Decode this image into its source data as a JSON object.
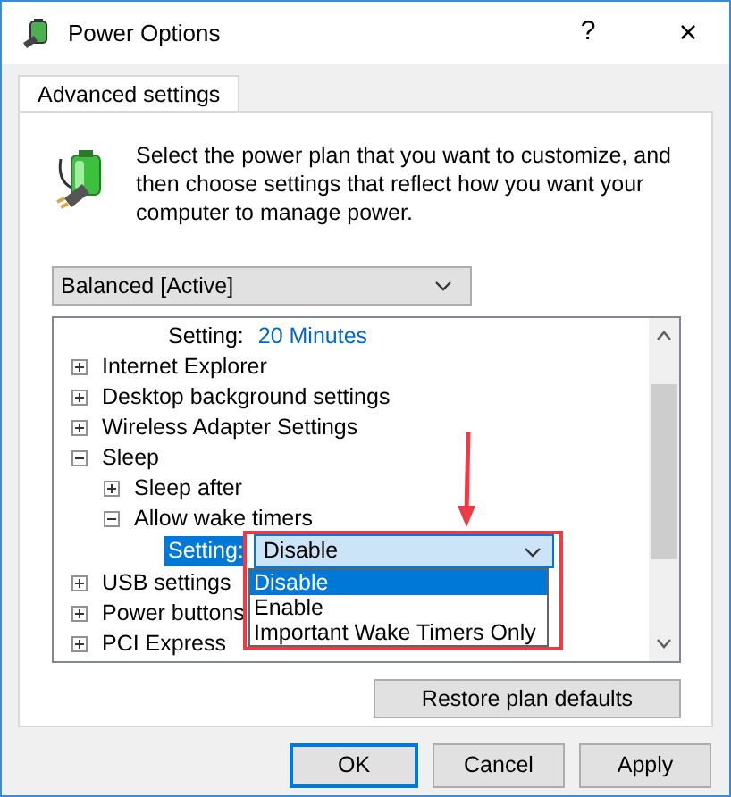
{
  "window": {
    "title": "Power Options",
    "help_button": "?",
    "close_button": "×"
  },
  "tabs": [
    {
      "label": "Advanced settings",
      "selected": true
    }
  ],
  "description": "Select the power plan that you want to customize, and then choose settings that reflect how you want your computer to manage power.",
  "plan_dropdown": {
    "value": "Balanced [Active]"
  },
  "settings_tree": [
    {
      "kind": "setting",
      "label": "Setting:",
      "value": "20 Minutes",
      "selected": false
    },
    {
      "kind": "group",
      "label": "Internet Explorer",
      "expanded": false
    },
    {
      "kind": "group",
      "label": "Desktop background settings",
      "expanded": false
    },
    {
      "kind": "group",
      "label": "Wireless Adapter Settings",
      "expanded": false
    },
    {
      "kind": "group",
      "label": "Sleep",
      "expanded": true,
      "children": [
        {
          "kind": "group",
          "label": "Sleep after",
          "expanded": false
        },
        {
          "kind": "group",
          "label": "Allow wake timers",
          "expanded": true,
          "children": [
            {
              "kind": "setting",
              "label": "Setting:",
              "selected": true,
              "dropdown": {
                "open": true,
                "value": "Disable",
                "options": [
                  {
                    "label": "Disable",
                    "selected": true
                  },
                  {
                    "label": "Enable",
                    "selected": false
                  },
                  {
                    "label": "Important Wake Timers Only",
                    "selected": false
                  }
                ]
              }
            }
          ]
        }
      ]
    },
    {
      "kind": "group",
      "label": "USB settings",
      "expanded": false
    },
    {
      "kind": "group",
      "label": "Power buttons",
      "expanded": false
    },
    {
      "kind": "group",
      "label": "PCI Express",
      "expanded": false
    }
  ],
  "restore_button": "Restore plan defaults",
  "buttons": [
    {
      "label": "OK",
      "default": true
    },
    {
      "label": "Cancel",
      "default": false
    },
    {
      "label": "Apply",
      "default": false
    }
  ]
}
